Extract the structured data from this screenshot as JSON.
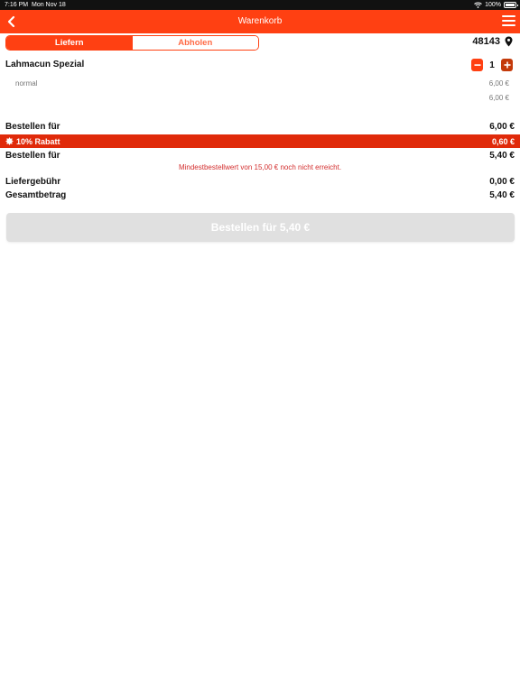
{
  "status_bar": {
    "time": "7:16 PM",
    "date": "Mon Nov 18",
    "battery": "100%"
  },
  "nav": {
    "title": "Warenkorb",
    "back_icon": "chevron-left-icon",
    "menu_icon": "hamburger-menu-icon"
  },
  "segment": {
    "options": [
      "Liefern",
      "Abholen"
    ],
    "selected": "Liefern"
  },
  "location": {
    "postal_code": "48143",
    "icon": "location-pin-icon"
  },
  "cart": {
    "items": [
      {
        "name": "Lahmacun Spezial",
        "quantity": "1",
        "variant": "normal",
        "variant_price": "6,00 €",
        "item_total": "6,00 €"
      }
    ]
  },
  "summary": {
    "order_for_label": "Bestellen für",
    "order_for_value": "6,00 €",
    "discount_label": "10% Rabatt",
    "discount_value": "0,60 €",
    "order_for_after_label": "Bestellen für",
    "order_for_after_value": "5,40 €",
    "min_order_message": "Mindestbestellwert von 15,00 € noch nicht erreicht.",
    "delivery_fee_label": "Liefergebühr",
    "delivery_fee_value": "0,00 €",
    "total_label": "Gesamtbetrag",
    "total_value": "5,40 €"
  },
  "order_button": {
    "label": "Bestellen für 5,40 €"
  },
  "colors": {
    "brand": "#ff4012",
    "discount_bar": "#e02a0a",
    "error_text": "#d32f2f",
    "disabled_button": "#e0e0e0"
  }
}
